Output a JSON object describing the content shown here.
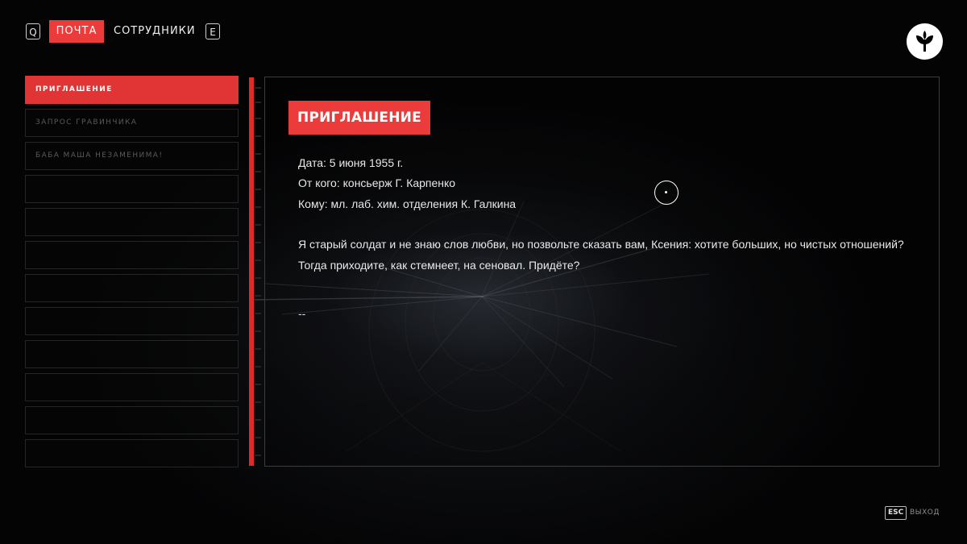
{
  "nav": {
    "prev_key": "Q",
    "next_key": "E",
    "tabs": [
      {
        "label": "ПОЧТА",
        "active": true
      },
      {
        "label": "СОТРУДНИКИ",
        "active": false
      }
    ],
    "logo_icon": "sprout-emblem-icon"
  },
  "mail_list": {
    "items": [
      {
        "label": "ПРИГЛАШЕНИЕ",
        "active": true
      },
      {
        "label": "ЗАПРОС ГРАВИНЧИКА",
        "active": false
      },
      {
        "label": "БАБА МАША НЕЗАМЕНИМА!",
        "active": false
      },
      {
        "label": "",
        "active": false
      },
      {
        "label": "",
        "active": false
      },
      {
        "label": "",
        "active": false
      },
      {
        "label": "",
        "active": false
      },
      {
        "label": "",
        "active": false
      },
      {
        "label": "",
        "active": false
      },
      {
        "label": "",
        "active": false
      },
      {
        "label": "",
        "active": false
      },
      {
        "label": "",
        "active": false
      }
    ]
  },
  "message": {
    "subject": "ПРИГЛАШЕНИЕ",
    "date": "Дата: 5 июня 1955 г.",
    "from": "От кого: консьерж Г. Карпенко",
    "to": "Кому: мл. лаб. хим. отделения К. Галкина",
    "body": "Я старый солдат и не знаю слов любви, но позвольте сказать вам, Ксения: хотите больших, но чистых отношений? Тогда приходите, как стемнеет, на сеновал. Придёте?",
    "signature": "--"
  },
  "footer": {
    "key": "ESC",
    "label": "ВЫХОД"
  },
  "colors": {
    "accent": "#ec3b3b",
    "background": "#000000",
    "text": "#eaeaea"
  }
}
